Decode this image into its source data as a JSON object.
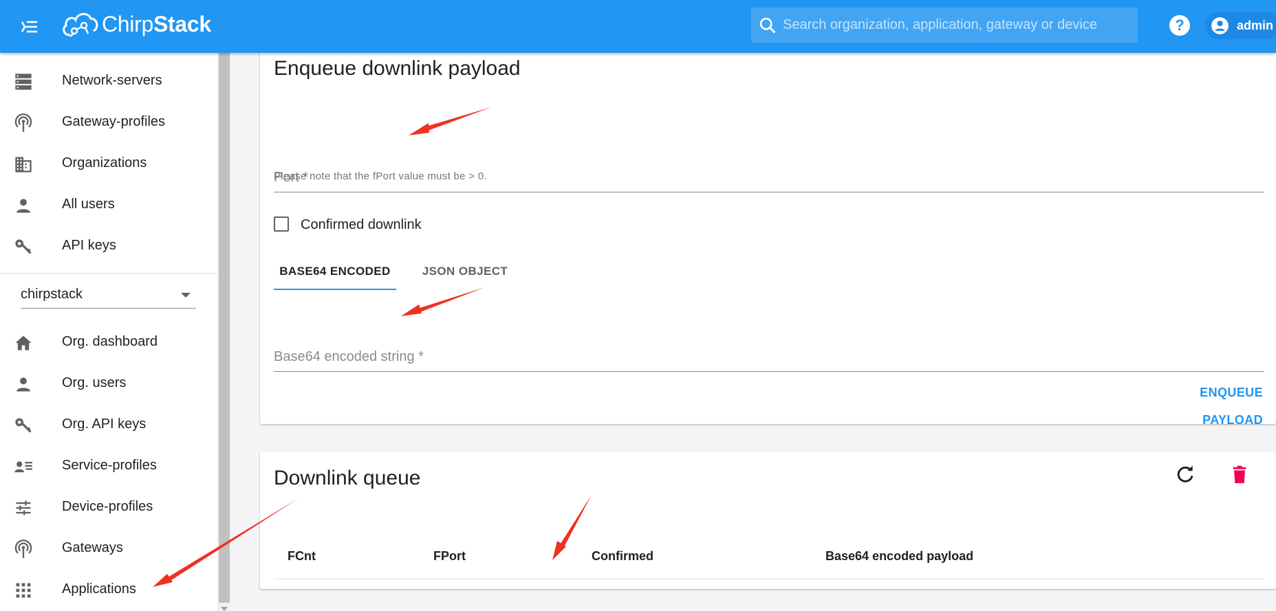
{
  "appbar": {
    "brand_light": "Chirp",
    "brand_bold": "Stack",
    "search_placeholder": "Search organization, application, gateway or device",
    "help_label": "?",
    "user_name": "admin",
    "color": "#2196f3"
  },
  "sidebar": {
    "admin_items": [
      {
        "label": "Network-servers",
        "icon": "server-icon"
      },
      {
        "label": "Gateway-profiles",
        "icon": "gateway-icon"
      },
      {
        "label": "Organizations",
        "icon": "building-icon"
      },
      {
        "label": "All users",
        "icon": "user-icon"
      },
      {
        "label": "API keys",
        "icon": "key-icon"
      }
    ],
    "org_select_value": "chirpstack",
    "org_items": [
      {
        "label": "Org. dashboard",
        "icon": "home-icon"
      },
      {
        "label": "Org. users",
        "icon": "user-icon"
      },
      {
        "label": "Org. API keys",
        "icon": "key-icon"
      },
      {
        "label": "Service-profiles",
        "icon": "account-details-icon"
      },
      {
        "label": "Device-profiles",
        "icon": "tune-icon"
      },
      {
        "label": "Gateways",
        "icon": "gateway-icon"
      },
      {
        "label": "Applications",
        "icon": "apps-icon"
      }
    ]
  },
  "enqueue": {
    "title": "Enqueue downlink payload",
    "port_placeholder": "Port *",
    "port_helper": "Please note that the fPort value must be > 0.",
    "confirmed_label": "Confirmed downlink",
    "confirmed_checked": false,
    "tabs": [
      "BASE64 ENCODED",
      "JSON OBJECT"
    ],
    "active_tab": "BASE64 ENCODED",
    "payload_placeholder": "Base64 encoded string *",
    "submit_label": "ENQUEUE PAYLOAD"
  },
  "queue": {
    "title": "Downlink queue",
    "refresh_icon": "refresh-icon",
    "delete_icon": "delete-icon",
    "delete_color": "#f50057",
    "columns": [
      "FCnt",
      "FPort",
      "Confirmed",
      "Base64 encoded payload"
    ]
  },
  "annotation_color": "#f03020"
}
